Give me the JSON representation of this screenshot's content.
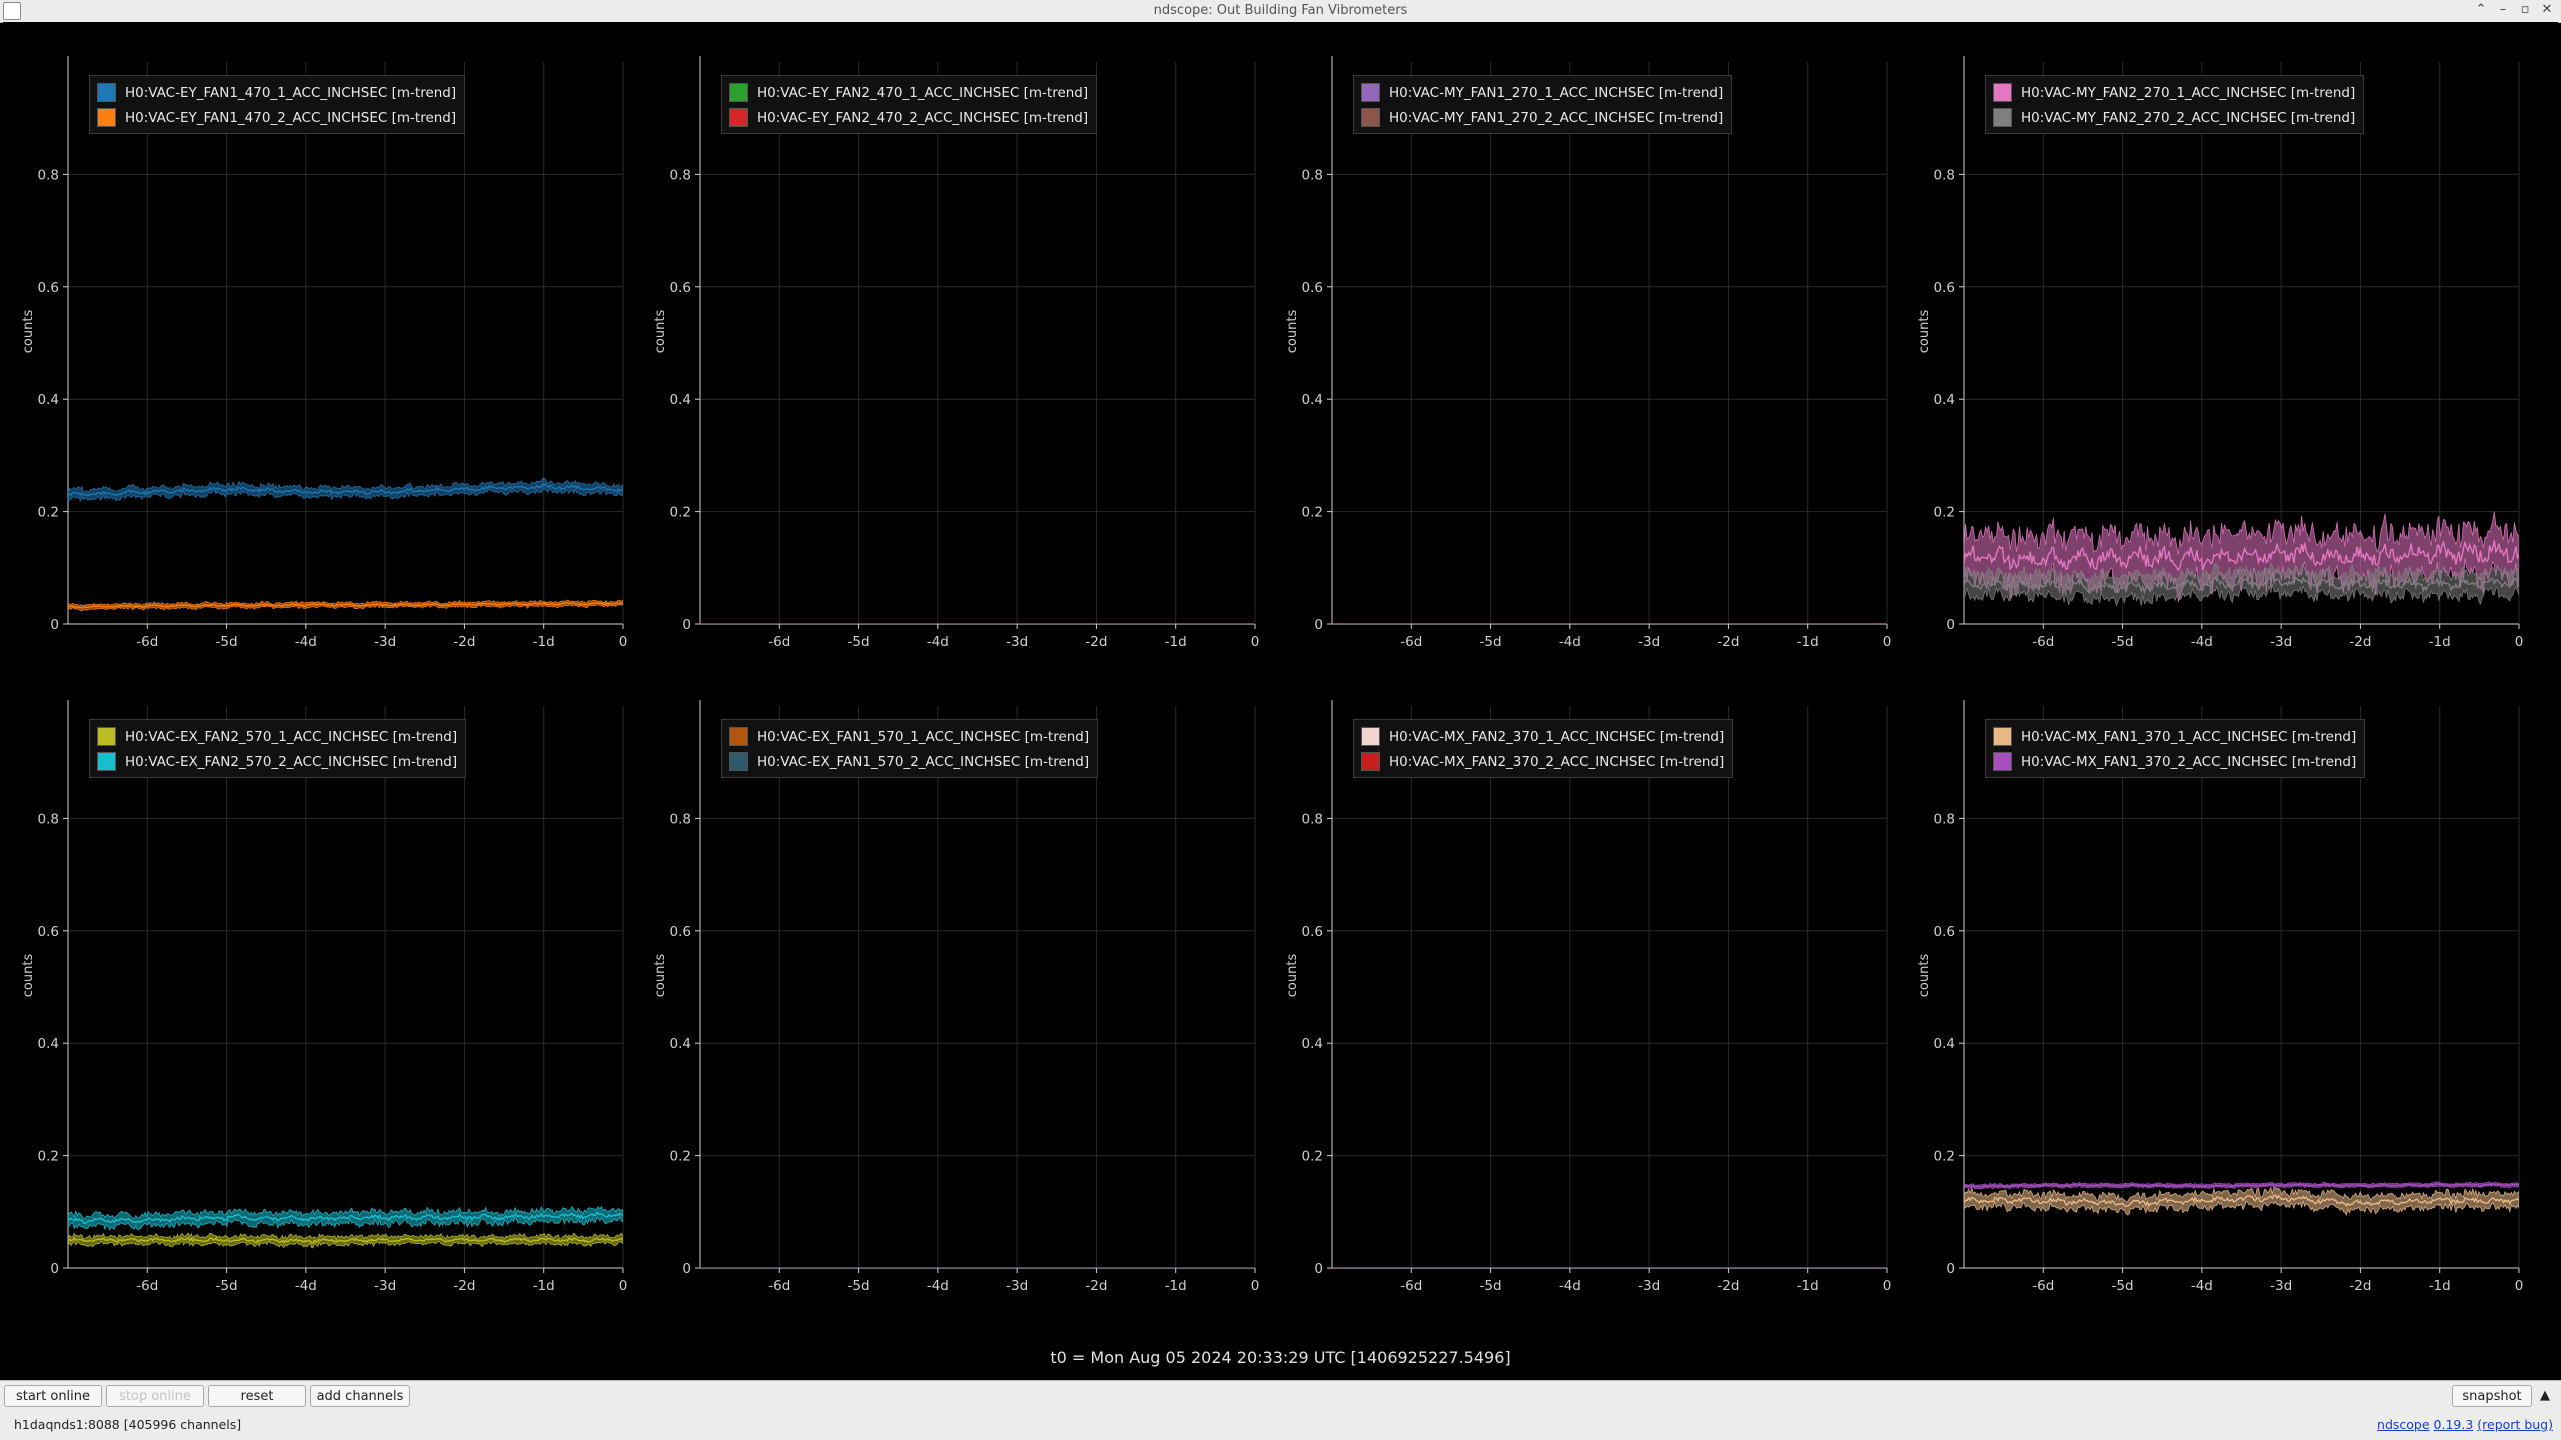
{
  "window": {
    "title": "ndscope: Out Building Fan Vibrometers"
  },
  "colors": {
    "background": "#000000",
    "grid": "#2a2a2a",
    "axis": "#cfcfcf"
  },
  "chart_data": [
    {
      "type": "line",
      "ylabel": "counts",
      "ylim": [
        0,
        1
      ],
      "yticks": [
        "0",
        "0.2",
        "0.4",
        "0.6",
        "0.8"
      ],
      "xticks": [
        "-6d",
        "-5d",
        "-4d",
        "-3d",
        "-2d",
        "-1d",
        "0"
      ],
      "grid": true,
      "legend": "top-left",
      "series": [
        {
          "name": "H0:VAC-EY_FAN1_470_1_ACC_INCHSEC [m-trend]",
          "color": "#1f77b4",
          "x": [
            -7,
            -6,
            -5,
            -4,
            -3,
            -2,
            -1,
            0
          ],
          "mean": [
            0.23,
            0.235,
            0.24,
            0.235,
            0.235,
            0.24,
            0.245,
            0.24
          ],
          "spread": 0.008
        },
        {
          "name": "H0:VAC-EY_FAN1_470_2_ACC_INCHSEC [m-trend]",
          "color": "#ff7f0e",
          "x": [
            -7,
            -6,
            -5,
            -4,
            -3,
            -2,
            -1,
            0
          ],
          "mean": [
            0.03,
            0.032,
            0.033,
            0.034,
            0.034,
            0.035,
            0.036,
            0.036
          ],
          "spread": 0.004
        }
      ]
    },
    {
      "type": "line",
      "ylabel": "counts",
      "ylim": [
        0,
        1
      ],
      "yticks": [
        "0",
        "0.2",
        "0.4",
        "0.6",
        "0.8"
      ],
      "xticks": [
        "-6d",
        "-5d",
        "-4d",
        "-3d",
        "-2d",
        "-1d",
        "0"
      ],
      "grid": true,
      "legend": "top-left",
      "series": [
        {
          "name": "H0:VAC-EY_FAN2_470_1_ACC_INCHSEC [m-trend]",
          "color": "#2ca02c",
          "x": [
            -7,
            0
          ],
          "mean": [
            0,
            0
          ],
          "spread": 0
        },
        {
          "name": "H0:VAC-EY_FAN2_470_2_ACC_INCHSEC [m-trend]",
          "color": "#d62728",
          "x": [
            -7,
            0
          ],
          "mean": [
            0,
            0
          ],
          "spread": 0
        }
      ]
    },
    {
      "type": "line",
      "ylabel": "counts",
      "ylim": [
        0,
        1
      ],
      "yticks": [
        "0",
        "0.2",
        "0.4",
        "0.6",
        "0.8"
      ],
      "xticks": [
        "-6d",
        "-5d",
        "-4d",
        "-3d",
        "-2d",
        "-1d",
        "0"
      ],
      "grid": true,
      "legend": "top-left",
      "series": [
        {
          "name": "H0:VAC-MY_FAN1_270_1_ACC_INCHSEC [m-trend]",
          "color": "#9467bd",
          "x": [
            -7,
            0
          ],
          "mean": [
            0,
            0
          ],
          "spread": 0
        },
        {
          "name": "H0:VAC-MY_FAN1_270_2_ACC_INCHSEC [m-trend]",
          "color": "#8c564b",
          "x": [
            -7,
            0
          ],
          "mean": [
            0,
            0
          ],
          "spread": 0
        }
      ]
    },
    {
      "type": "line",
      "ylabel": "counts",
      "ylim": [
        0,
        1
      ],
      "yticks": [
        "0",
        "0.2",
        "0.4",
        "0.6",
        "0.8"
      ],
      "xticks": [
        "-6d",
        "-5d",
        "-4d",
        "-3d",
        "-2d",
        "-1d",
        "0"
      ],
      "grid": true,
      "legend": "top-left",
      "series": [
        {
          "name": "H0:VAC-MY_FAN2_270_1_ACC_INCHSEC [m-trend]",
          "color": "#e377c2",
          "x": [
            -7,
            -6,
            -5,
            -4,
            -3,
            -2,
            -1,
            0
          ],
          "mean": [
            0.12,
            0.115,
            0.12,
            0.115,
            0.125,
            0.12,
            0.125,
            0.13
          ],
          "spread": 0.04
        },
        {
          "name": "H0:VAC-MY_FAN2_270_2_ACC_INCHSEC [m-trend]",
          "color": "#7f7f7f",
          "x": [
            -7,
            -6,
            -5,
            -4,
            -3,
            -2,
            -1,
            0
          ],
          "mean": [
            0.07,
            0.07,
            0.065,
            0.07,
            0.075,
            0.07,
            0.07,
            0.075
          ],
          "spread": 0.02
        }
      ]
    },
    {
      "type": "line",
      "ylabel": "counts",
      "ylim": [
        0,
        1
      ],
      "yticks": [
        "0",
        "0.2",
        "0.4",
        "0.6",
        "0.8"
      ],
      "xticks": [
        "-6d",
        "-5d",
        "-4d",
        "-3d",
        "-2d",
        "-1d",
        "0"
      ],
      "grid": true,
      "legend": "top-left",
      "series": [
        {
          "name": "H0:VAC-EX_FAN2_570_1_ACC_INCHSEC [m-trend]",
          "color": "#bcbd22",
          "x": [
            -7,
            -6,
            -5,
            -4,
            -3,
            -2,
            -1,
            0
          ],
          "mean": [
            0.05,
            0.05,
            0.05,
            0.048,
            0.05,
            0.05,
            0.05,
            0.05
          ],
          "spread": 0.007
        },
        {
          "name": "H0:VAC-EX_FAN2_570_2_ACC_INCHSEC [m-trend]",
          "color": "#17becf",
          "x": [
            -7,
            -6,
            -5,
            -4,
            -3,
            -2,
            -1,
            0
          ],
          "mean": [
            0.085,
            0.085,
            0.09,
            0.088,
            0.09,
            0.09,
            0.092,
            0.095
          ],
          "spread": 0.01
        }
      ]
    },
    {
      "type": "line",
      "ylabel": "counts",
      "ylim": [
        0,
        1
      ],
      "yticks": [
        "0",
        "0.2",
        "0.4",
        "0.6",
        "0.8"
      ],
      "xticks": [
        "-6d",
        "-5d",
        "-4d",
        "-3d",
        "-2d",
        "-1d",
        "0"
      ],
      "grid": true,
      "legend": "top-left",
      "series": [
        {
          "name": "H0:VAC-EX_FAN1_570_1_ACC_INCHSEC [m-trend]",
          "color": "#b1560f",
          "x": [
            -7,
            0
          ],
          "mean": [
            0,
            0
          ],
          "spread": 0
        },
        {
          "name": "H0:VAC-EX_FAN1_570_2_ACC_INCHSEC [m-trend]",
          "color": "#2e5a6b",
          "x": [
            -7,
            0
          ],
          "mean": [
            0,
            0
          ],
          "spread": 0
        }
      ]
    },
    {
      "type": "line",
      "ylabel": "counts",
      "ylim": [
        0,
        1
      ],
      "yticks": [
        "0",
        "0.2",
        "0.4",
        "0.6",
        "0.8"
      ],
      "xticks": [
        "-6d",
        "-5d",
        "-4d",
        "-3d",
        "-2d",
        "-1d",
        "0"
      ],
      "grid": true,
      "legend": "top-left",
      "series": [
        {
          "name": "H0:VAC-MX_FAN2_370_1_ACC_INCHSEC [m-trend]",
          "color": "#f2d5d0",
          "x": [
            -7,
            0
          ],
          "mean": [
            0,
            0
          ],
          "spread": 0
        },
        {
          "name": "H0:VAC-MX_FAN2_370_2_ACC_INCHSEC [m-trend]",
          "color": "#c41e1e",
          "x": [
            -7,
            0
          ],
          "mean": [
            0,
            0
          ],
          "spread": 0
        }
      ]
    },
    {
      "type": "line",
      "ylabel": "counts",
      "ylim": [
        0,
        1
      ],
      "yticks": [
        "0",
        "0.2",
        "0.4",
        "0.6",
        "0.8"
      ],
      "xticks": [
        "-6d",
        "-5d",
        "-4d",
        "-3d",
        "-2d",
        "-1d",
        "0"
      ],
      "grid": true,
      "legend": "top-left",
      "series": [
        {
          "name": "H0:VAC-MX_FAN1_370_1_ACC_INCHSEC [m-trend]",
          "color": "#e8b887",
          "x": [
            -7,
            -6,
            -5,
            -4,
            -3,
            -2,
            -1,
            0
          ],
          "mean": [
            0.12,
            0.12,
            0.115,
            0.12,
            0.125,
            0.115,
            0.12,
            0.12
          ],
          "spread": 0.012
        },
        {
          "name": "H0:VAC-MX_FAN1_370_2_ACC_INCHSEC [m-trend]",
          "color": "#a64fbf",
          "x": [
            -7,
            -6,
            -5,
            -4,
            -3,
            -2,
            -1,
            0
          ],
          "mean": [
            0.145,
            0.147,
            0.147,
            0.146,
            0.148,
            0.147,
            0.148,
            0.148
          ],
          "spread": 0.003
        }
      ]
    }
  ],
  "t0_label": "t0 = Mon Aug 05 2024 20:33:29 UTC [1406925227.5496]",
  "toolbar": {
    "start_online": "start online",
    "stop_online": "stop online",
    "reset": "reset",
    "add_channels": "add channels",
    "snapshot": "snapshot"
  },
  "status": {
    "server": "h1daqnds1:8088",
    "channels": "[405996 channels]",
    "app_name": "ndscope",
    "version": "0.19.3",
    "report_bug": "(report bug)"
  }
}
